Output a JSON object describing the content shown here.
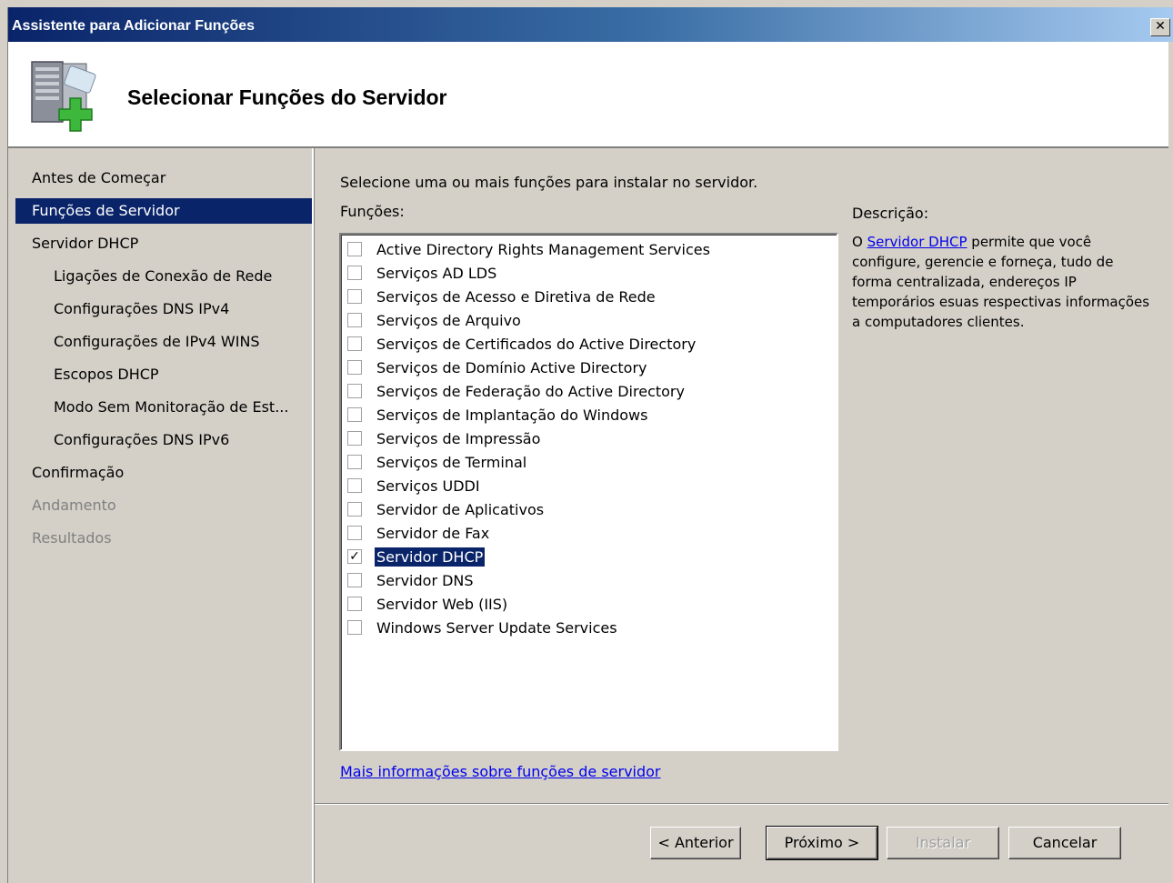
{
  "window": {
    "title": "Assistente para Adicionar Funções",
    "close_glyph": "✕"
  },
  "header": {
    "title": "Selecionar Funções do Servidor",
    "icon": "server-add-icon"
  },
  "nav": {
    "items": [
      {
        "label": "Antes de Começar",
        "state": "normal",
        "level": 0
      },
      {
        "label": "Funções de Servidor",
        "state": "selected",
        "level": 0
      },
      {
        "label": "Servidor DHCP",
        "state": "normal",
        "level": 0
      },
      {
        "label": "Ligações de Conexão de Rede",
        "state": "normal",
        "level": 1
      },
      {
        "label": "Configurações DNS IPv4",
        "state": "normal",
        "level": 1
      },
      {
        "label": "Configurações de IPv4 WINS",
        "state": "normal",
        "level": 1
      },
      {
        "label": "Escopos DHCP",
        "state": "normal",
        "level": 1
      },
      {
        "label": "Modo Sem Monitoração de Est...",
        "state": "normal",
        "level": 1
      },
      {
        "label": "Configurações DNS IPv6",
        "state": "normal",
        "level": 1
      },
      {
        "label": "Confirmação",
        "state": "normal",
        "level": 0
      },
      {
        "label": "Andamento",
        "state": "disabled",
        "level": 0
      },
      {
        "label": "Resultados",
        "state": "disabled",
        "level": 0
      }
    ]
  },
  "main": {
    "instruction": "Selecione uma ou mais funções para instalar no servidor.",
    "roles_label": "Funções:",
    "roles": [
      {
        "label": "Active Directory Rights Management Services",
        "checked": false
      },
      {
        "label": "Serviços AD LDS",
        "checked": false
      },
      {
        "label": "Serviços de Acesso e Diretiva de Rede",
        "checked": false
      },
      {
        "label": "Serviços de Arquivo",
        "checked": false
      },
      {
        "label": "Serviços de Certificados do Active Directory",
        "checked": false
      },
      {
        "label": "Serviços de Domínio Active Directory",
        "checked": false
      },
      {
        "label": "Serviços de Federação do Active Directory",
        "checked": false
      },
      {
        "label": "Serviços de Implantação do Windows",
        "checked": false
      },
      {
        "label": "Serviços de Impressão",
        "checked": false
      },
      {
        "label": "Serviços de Terminal",
        "checked": false
      },
      {
        "label": "Serviços UDDI",
        "checked": false
      },
      {
        "label": "Servidor de Aplicativos",
        "checked": false
      },
      {
        "label": "Servidor de Fax",
        "checked": false
      },
      {
        "label": "Servidor DHCP",
        "checked": true
      },
      {
        "label": "Servidor DNS",
        "checked": false
      },
      {
        "label": "Servidor Web (IIS)",
        "checked": false
      },
      {
        "label": "Windows Server Update Services",
        "checked": false
      }
    ],
    "more_info_link": "Mais informações sobre funções de servidor",
    "description": {
      "title": "Descrição:",
      "prefix": "O ",
      "link": "Servidor DHCP",
      "text": " permite que você configure, gerencie e forneça, tudo de forma centralizada, endereços IP temporários esuas respectivas informações a computadores clientes."
    }
  },
  "buttons": {
    "previous": "< Anterior",
    "next": "Próximo >",
    "install": "Instalar",
    "cancel": "Cancelar"
  },
  "check_glyph": "✓"
}
